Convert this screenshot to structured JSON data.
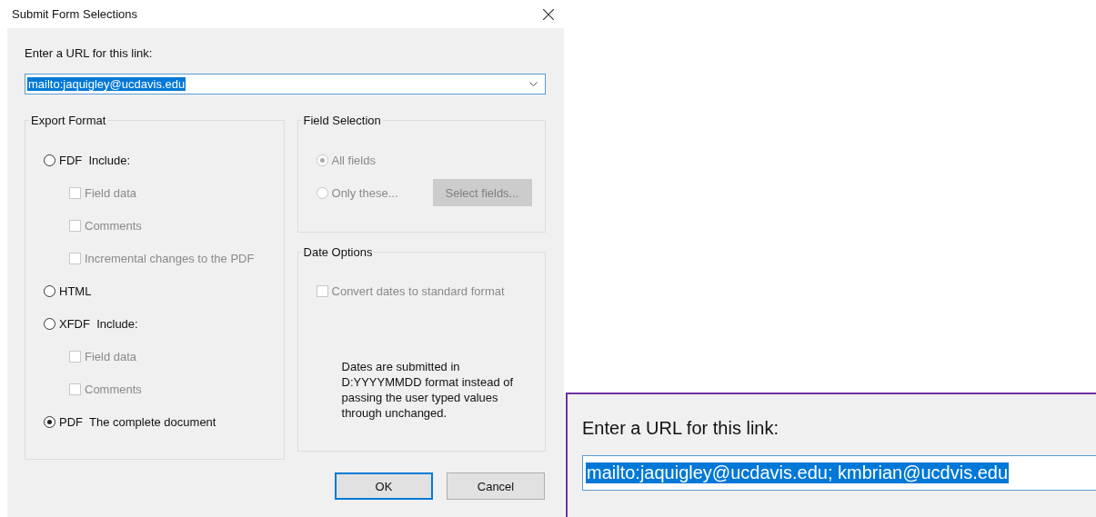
{
  "window": {
    "title": "Submit Form Selections"
  },
  "url": {
    "label": "Enter a URL for this link:",
    "value": "mailto:jaquigley@ucdavis.edu",
    "highlighted": true
  },
  "export_format": {
    "title": "Export Format",
    "options": [
      {
        "label": "FDF  Include:",
        "selected": false,
        "includes": [
          {
            "label": "Field data",
            "checked": false,
            "disabled": true
          },
          {
            "label": "Comments",
            "checked": false,
            "disabled": true
          },
          {
            "label": "Incremental changes to the PDF",
            "checked": false,
            "disabled": true
          }
        ]
      },
      {
        "label": "HTML",
        "selected": false
      },
      {
        "label": "XFDF  Include:",
        "selected": false,
        "includes": [
          {
            "label": "Field data",
            "checked": false,
            "disabled": true
          },
          {
            "label": "Comments",
            "checked": false,
            "disabled": true
          }
        ]
      },
      {
        "label": "PDF  The complete document",
        "selected": true
      }
    ]
  },
  "field_selection": {
    "title": "Field Selection",
    "disabled": true,
    "options": [
      {
        "label": "All fields",
        "selected": true
      },
      {
        "label": "Only these...",
        "selected": false
      }
    ],
    "button": "Select fields..."
  },
  "date_options": {
    "title": "Date Options",
    "checkbox": {
      "label": "Convert dates to standard format",
      "checked": false,
      "disabled": true
    },
    "note": "Dates are submitted in D:YYYYMMDD format instead of passing the user typed values through unchanged."
  },
  "buttons": [
    {
      "label": "OK",
      "default": true
    },
    {
      "label": "Cancel",
      "default": false
    }
  ],
  "zoom_inset": {
    "label": "Enter a URL for this link:",
    "value": "mailto:jaquigley@ucdavis.edu; kmbrian@ucdvis.edu",
    "highlighted": true
  }
}
